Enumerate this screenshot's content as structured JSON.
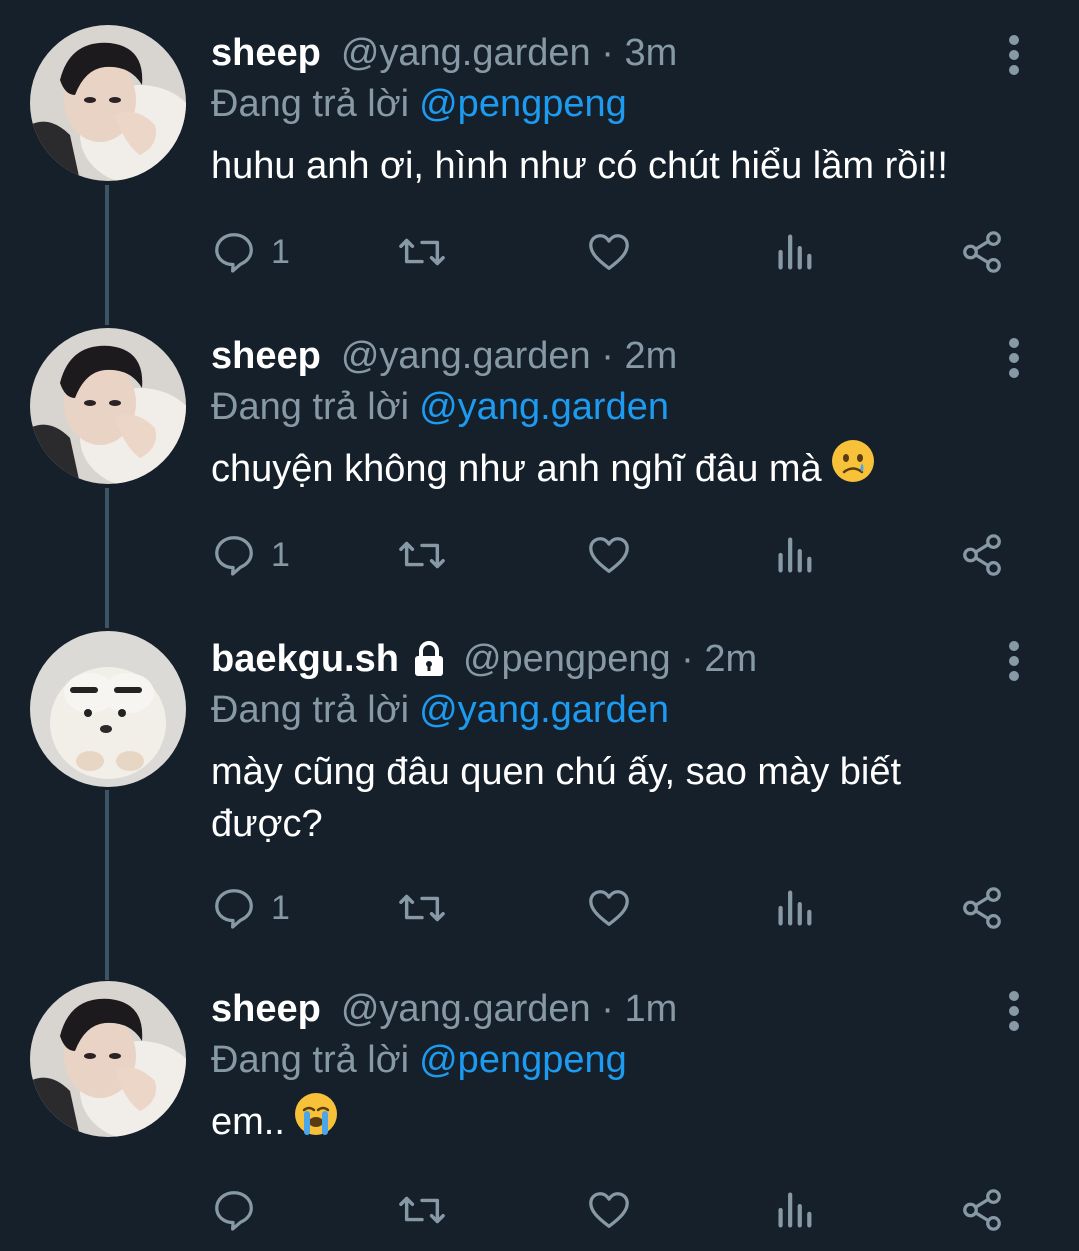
{
  "colors": {
    "background": "#15202b",
    "secondary_text": "#8899a6",
    "mention": "#1d9bf0",
    "thread_line": "#3d5466"
  },
  "replying_prefix": "Đang trả lời",
  "tweets": [
    {
      "avatar": "boy-avatar",
      "display_name": "sheep",
      "handle": "@yang.garden",
      "time": "3m",
      "reply_to": "@pengpeng",
      "text": "huhu anh ơi, hình như có chút hiểu lầm rồi!!",
      "emoji": "",
      "reply_count": "1",
      "locked": false
    },
    {
      "avatar": "boy-avatar",
      "display_name": "sheep",
      "handle": "@yang.garden",
      "time": "2m",
      "reply_to": "@yang.garden",
      "text": "chuyện không như anh nghĩ đâu mà",
      "emoji": "crying-face-emoji",
      "reply_count": "1",
      "locked": false
    },
    {
      "avatar": "puppy-avatar",
      "display_name": "baekgu.sh",
      "handle": "@pengpeng",
      "time": "2m",
      "reply_to": "@yang.garden",
      "text": "mày cũng đâu quen chú ấy, sao mày biết\nđược?",
      "emoji": "",
      "reply_count": "1",
      "locked": true
    },
    {
      "avatar": "boy-avatar",
      "display_name": "sheep",
      "handle": "@yang.garden",
      "time": "1m",
      "reply_to": "@pengpeng",
      "text": "em..",
      "emoji": "loudly-crying-face-emoji",
      "reply_count": "",
      "locked": false
    }
  ]
}
